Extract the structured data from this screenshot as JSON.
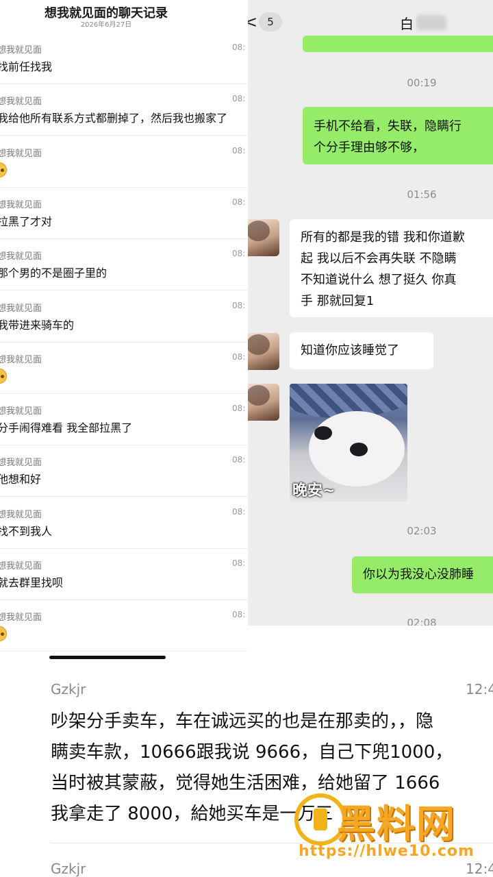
{
  "history": {
    "title": "想我就见面的聊天记录",
    "date": "2026年6月27日",
    "records": [
      {
        "name": "想我就见面",
        "time": "08:",
        "text": "找前任找我",
        "emoji": false
      },
      {
        "name": "想我就见面",
        "time": "08:",
        "text": "我给他所有联系方式都删掉了，然后我也搬家了",
        "emoji": false
      },
      {
        "name": "想我就见面",
        "time": "08:",
        "text": "",
        "emoji": true
      },
      {
        "name": "想我就见面",
        "time": "08:",
        "text": "拉黑了才对",
        "emoji": false
      },
      {
        "name": "想我就见面",
        "time": "08:",
        "text": "那个男的不是圈子里的",
        "emoji": false
      },
      {
        "name": "想我就见面",
        "time": "08:",
        "text": "我带进来骑车的",
        "emoji": false
      },
      {
        "name": "想我就见面",
        "time": "08:",
        "text": "",
        "emoji": true
      },
      {
        "name": "想我就见面",
        "time": "08:",
        "text": "分手闹得难看 我全部拉黑了",
        "emoji": false
      },
      {
        "name": "想我就见面",
        "time": "08:",
        "text": "他想和好",
        "emoji": false
      },
      {
        "name": "想我就见面",
        "time": "08:",
        "text": "找不到我人",
        "emoji": false
      },
      {
        "name": "想我就见面",
        "time": "08:",
        "text": "就去群里找呗",
        "emoji": false
      },
      {
        "name": "想我就见面",
        "time": "08:",
        "text": "",
        "emoji": true
      }
    ]
  },
  "chat": {
    "back_glyph": "<",
    "unread": "5",
    "contact_name": "白",
    "time1": "00:19",
    "msg_out1_l1": "手机不给看，失联，隐瞒行",
    "msg_out1_l2": "个分手理由够不够，",
    "time2": "01:56",
    "msg_in1_l1": "所有的都是我的错 我和你道歉",
    "msg_in1_l2": "起 我以后不会再失联 不隐瞒",
    "msg_in1_l3": "不知道说什么 想了挺久 你真",
    "msg_in1_l4": "手 那就回复1",
    "msg_in2": "知道你应该睡觉了",
    "sticker_label": "晚安~",
    "time3": "02:03",
    "msg_out2": "你以为我没心没肺睡",
    "time4": "02:08"
  },
  "comments": [
    {
      "name": "Gzkjr",
      "time": "12:4",
      "lines": [
        "吵架分手卖车，车在诚远买的也是在那卖的，，隐",
        "瞒卖车款，10666跟我说 9666，自己下兜1000，",
        "当时被其蒙蔽，觉得她生活困难，给她留了 1666",
        "我拿走了 8000，給她买车是一万三"
      ]
    },
    {
      "name": "Gzkjr",
      "time": "12:4",
      "lines": []
    }
  ],
  "watermark": {
    "brand": "黑料网",
    "url": "https://hlwe10.com"
  }
}
